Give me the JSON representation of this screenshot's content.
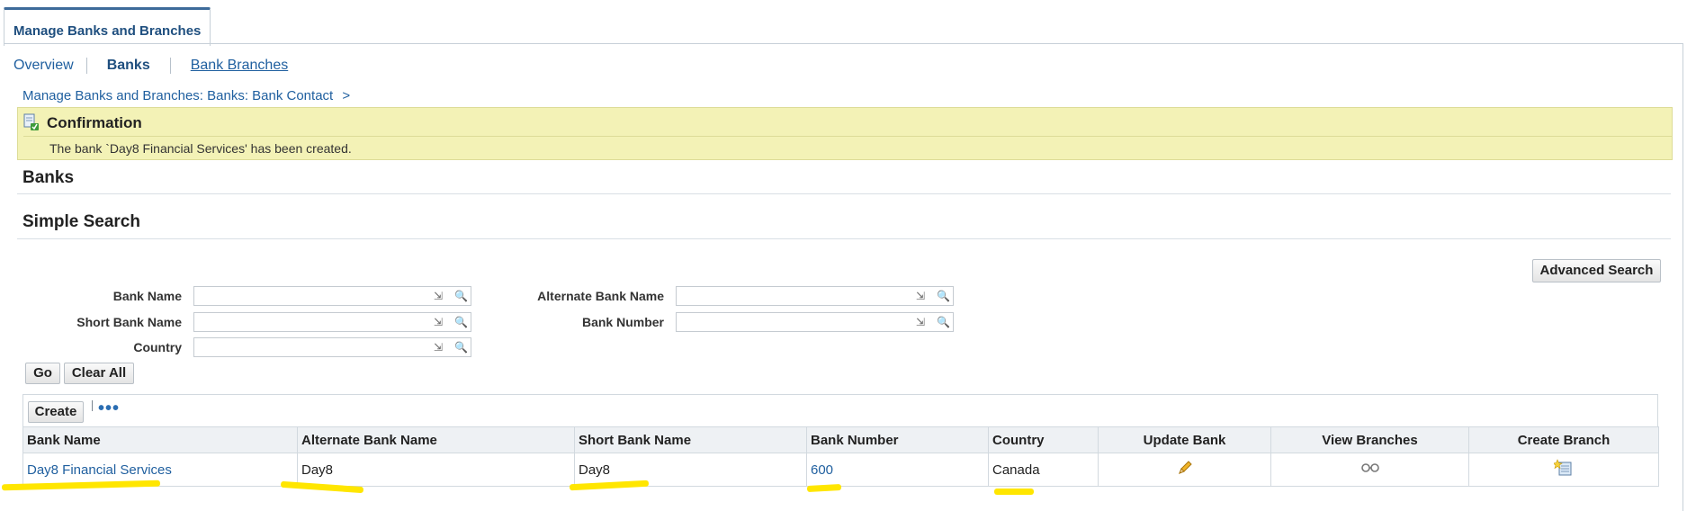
{
  "top_tab": {
    "label": "Manage Banks and Branches"
  },
  "subtabs": [
    {
      "label": "Overview"
    },
    {
      "label": "Banks"
    },
    {
      "label": "Bank Branches"
    }
  ],
  "breadcrumb": {
    "text": "Manage Banks and Branches: Banks: Bank Contact",
    "separator": ">"
  },
  "confirmation": {
    "title": "Confirmation",
    "message": "The bank `Day8 Financial Services' has been created."
  },
  "banks_heading": "Banks",
  "search": {
    "heading": "Simple Search",
    "advanced_label": "Advanced Search",
    "fields": {
      "bank_name": {
        "label": "Bank Name",
        "value": ""
      },
      "short_bank_name": {
        "label": "Short Bank Name",
        "value": ""
      },
      "country": {
        "label": "Country",
        "value": ""
      },
      "alternate_bank_name": {
        "label": "Alternate Bank Name",
        "value": ""
      },
      "bank_number": {
        "label": "Bank Number",
        "value": ""
      }
    },
    "go_label": "Go",
    "clear_label": "Clear All"
  },
  "results": {
    "create_label": "Create",
    "more_label": "•••",
    "columns": [
      "Bank Name",
      "Alternate Bank Name",
      "Short Bank Name",
      "Bank Number",
      "Country",
      "Update Bank",
      "View Branches",
      "Create Branch"
    ],
    "rows": [
      {
        "bank_name": "Day8 Financial Services",
        "alternate_bank_name": "Day8",
        "short_bank_name": "Day8",
        "bank_number": "600",
        "country": "Canada"
      }
    ]
  },
  "colors": {
    "link": "#1f5f9f",
    "confirmation_bg": "#f3f2b6",
    "highlight": "#ffe600",
    "tab_accent": "#3d6b9a"
  },
  "icons": [
    "confirmation-icon",
    "lov-icon",
    "search-icon",
    "pencil-icon",
    "glasses-icon",
    "create-branch-icon"
  ]
}
